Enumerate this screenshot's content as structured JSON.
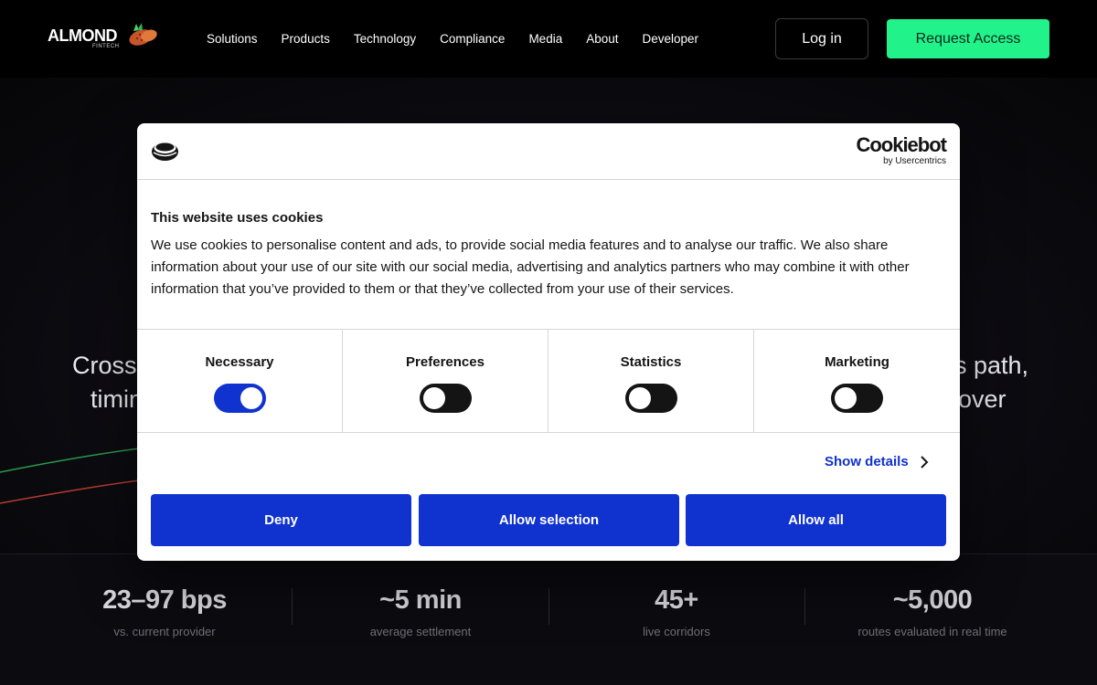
{
  "header": {
    "logo_text": "ALMOND",
    "logo_sub": "FINTECH",
    "nav": [
      "Solutions",
      "Products",
      "Technology",
      "Compliance",
      "Media",
      "About",
      "Developer"
    ],
    "login_label": "Log in",
    "request_label": "Request Access"
  },
  "hero": {
    "line1_left": "Cross",
    "line1_right": "s path,",
    "line2_left": "timin",
    "line2_right": "over"
  },
  "stats": [
    {
      "value": "23–97 bps",
      "label": "vs. current provider"
    },
    {
      "value": "~5 min",
      "label": "average settlement"
    },
    {
      "value": "45+",
      "label": "live corridors"
    },
    {
      "value": "~5,000",
      "label": "routes evaluated in real time"
    }
  ],
  "cookie": {
    "brand": "Cookiebot",
    "brand_sub": "by Usercentrics",
    "title": "This website uses cookies",
    "body": "We use cookies to personalise content and ads, to provide social media features and to analyse our traffic. We also share information about your use of our site with our social media, advertising and analytics partners who may combine it with other information that you’ve provided to them or that they’ve collected from your use of their services.",
    "categories": [
      {
        "label": "Necessary",
        "enabled": true
      },
      {
        "label": "Preferences",
        "enabled": false
      },
      {
        "label": "Statistics",
        "enabled": false
      },
      {
        "label": "Marketing",
        "enabled": false
      }
    ],
    "show_details": "Show details",
    "deny": "Deny",
    "allow_selection": "Allow selection",
    "allow_all": "Allow all"
  },
  "colors": {
    "accent_green": "#22f28a",
    "cookie_blue": "#1032cf"
  }
}
